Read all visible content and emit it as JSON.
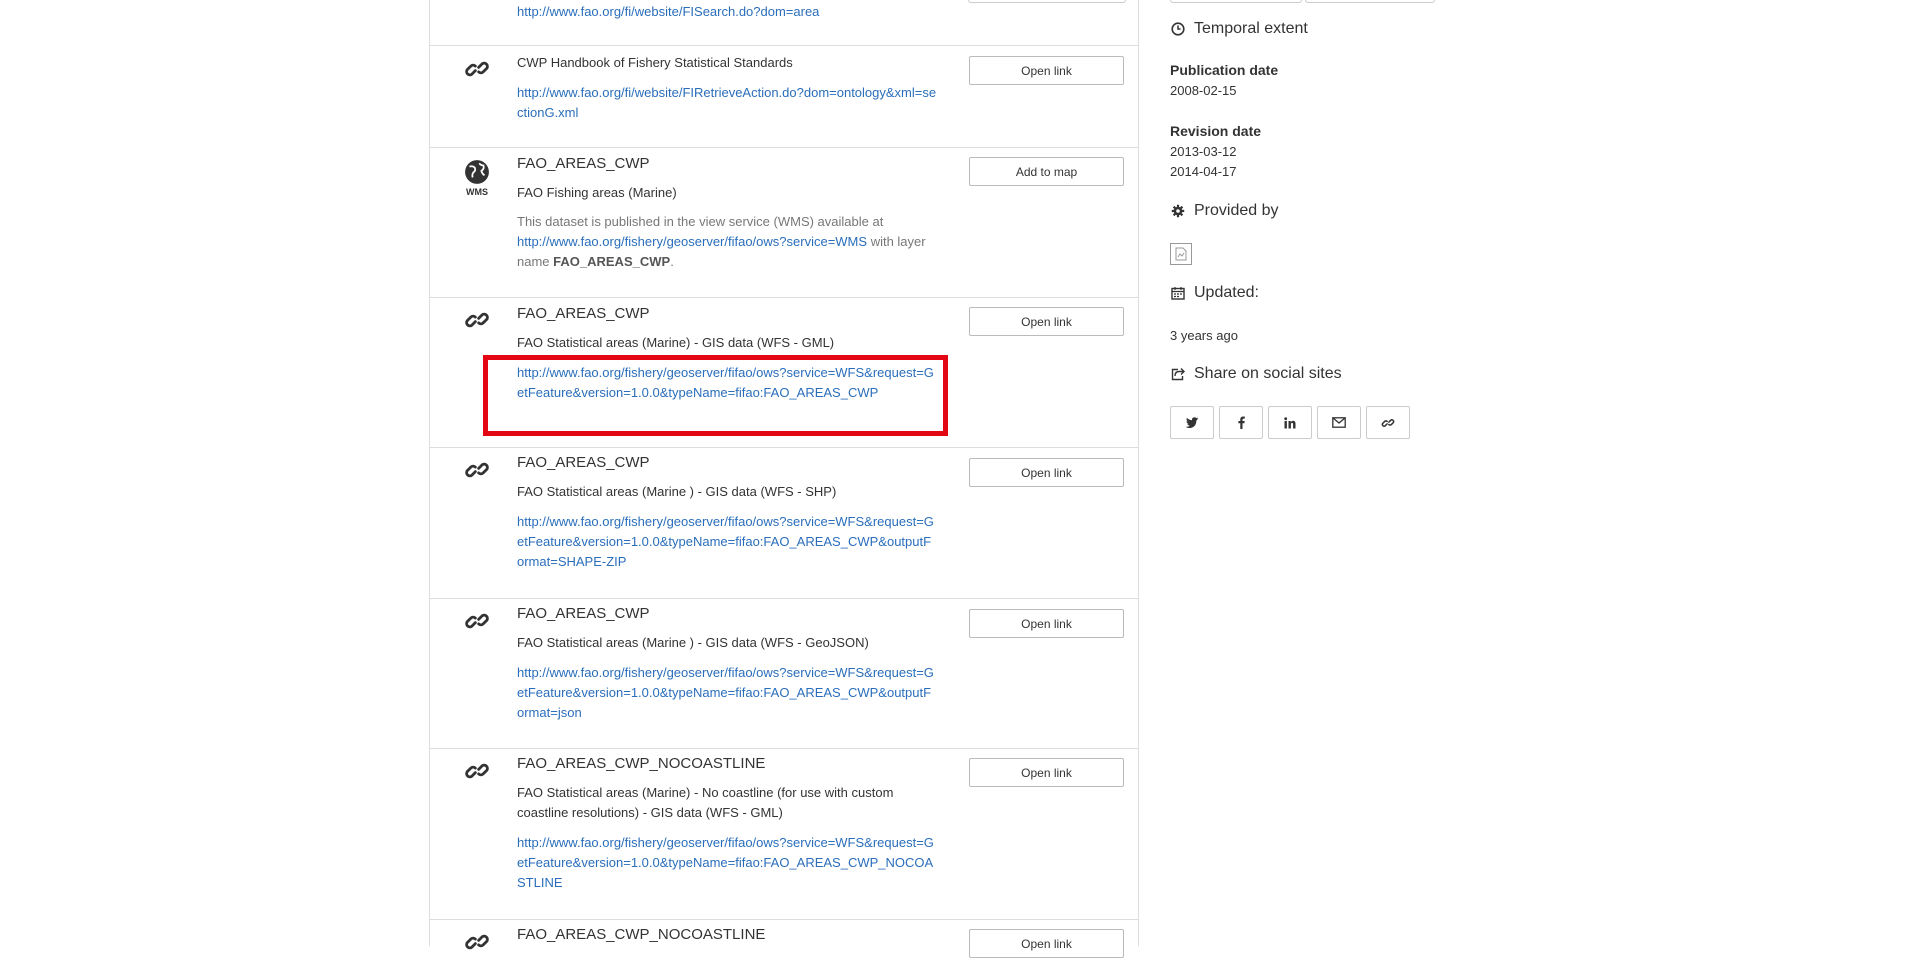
{
  "resources": [
    {
      "title": "",
      "subtitle": "",
      "link": "http://www.fao.org/fi/website/FISearch.do?dom=area",
      "button": ""
    },
    {
      "title": "CWP Handbook of Fishery Statistical Standards",
      "link": "http://www.fao.org/fi/website/FIRetrieveAction.do?dom=ontology&xml=sectionG.xml",
      "button": "Open link"
    },
    {
      "title": "FAO_AREAS_CWP",
      "subtitle": "FAO Fishing areas (Marine)",
      "description_pre": "This dataset is published in the view service (WMS) available at",
      "link": "http://www.fao.org/fishery/geoserver/fifao/ows?service=WMS",
      "description_post_a": "with layer name",
      "layer_name": "FAO_AREAS_CWP",
      "description_post_b": ".",
      "icon_label": "WMS",
      "button": "Add to map"
    },
    {
      "title": "FAO_AREAS_CWP",
      "subtitle": "FAO Statistical areas (Marine) - GIS data (WFS - GML)",
      "link": "http://www.fao.org/fishery/geoserver/fifao/ows?service=WFS&request=GetFeature&version=1.0.0&typeName=fifao:FAO_AREAS_CWP",
      "button": "Open link"
    },
    {
      "title": "FAO_AREAS_CWP",
      "subtitle": "FAO Statistical areas (Marine ) - GIS data (WFS - SHP)",
      "link": "http://www.fao.org/fishery/geoserver/fifao/ows?service=WFS&request=GetFeature&version=1.0.0&typeName=fifao:FAO_AREAS_CWP&outputFormat=SHAPE-ZIP",
      "button": "Open link"
    },
    {
      "title": "FAO_AREAS_CWP",
      "subtitle": "FAO Statistical areas (Marine ) - GIS data (WFS - GeoJSON)",
      "link": "http://www.fao.org/fishery/geoserver/fifao/ows?service=WFS&request=GetFeature&version=1.0.0&typeName=fifao:FAO_AREAS_CWP&outputFormat=json",
      "button": "Open link"
    },
    {
      "title": "FAO_AREAS_CWP_NOCOASTLINE",
      "subtitle": "FAO Statistical areas (Marine) - No coastline (for use with custom coastline resolutions) - GIS data (WFS - GML)",
      "link": "http://www.fao.org/fishery/geoserver/fifao/ows?service=WFS&request=GetFeature&version=1.0.0&typeName=fifao:FAO_AREAS_CWP_NOCOASTLINE",
      "button": "Open link"
    },
    {
      "title": "FAO_AREAS_CWP_NOCOASTLINE",
      "button": "Open link"
    }
  ],
  "sidebar": {
    "temporal_extent": "Temporal extent",
    "publication_label": "Publication date",
    "publication_date": "2008-02-15",
    "revision_label": "Revision date",
    "revision_dates": [
      "2013-03-12",
      "2014-04-17"
    ],
    "provided_by": "Provided by",
    "updated_label": "Updated:",
    "updated_value": "3 years ago",
    "share_label": "Share on social sites",
    "share_buttons": [
      "twitter-icon",
      "facebook-icon",
      "linkedin-icon",
      "envelope-icon",
      "link-icon"
    ]
  },
  "colors": {
    "link": "#2a6ebb",
    "highlight": "#e30613",
    "border": "#dddddd"
  }
}
